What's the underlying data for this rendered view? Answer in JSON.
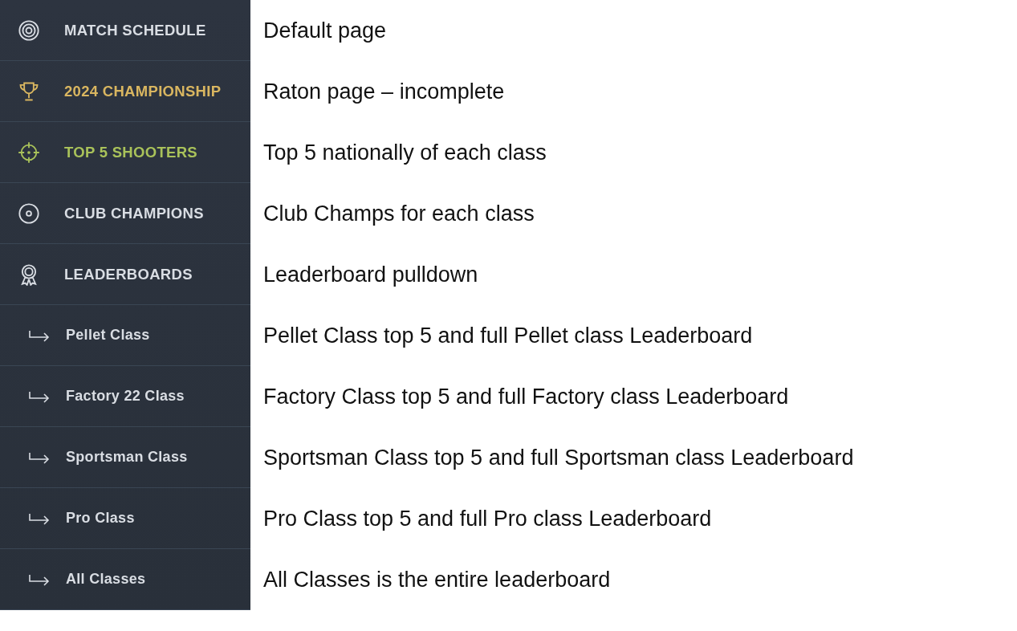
{
  "sidebar": {
    "items": [
      {
        "label": "MATCH SCHEDULE",
        "color": "#d9dde3"
      },
      {
        "label": "2024 CHAMPIONSHIP",
        "color": "#d9b660"
      },
      {
        "label": "TOP 5 SHOOTERS",
        "color": "#a9c25a"
      },
      {
        "label": "CLUB CHAMPIONS",
        "color": "#d9dde3"
      },
      {
        "label": "LEADERBOARDS",
        "color": "#d9dde3",
        "children": [
          {
            "label": "Pellet Class"
          },
          {
            "label": "Factory 22 Class"
          },
          {
            "label": "Sportsman Class"
          },
          {
            "label": "Pro Class"
          },
          {
            "label": "All Classes"
          }
        ]
      }
    ]
  },
  "notes": [
    "Default page",
    "Raton page – incomplete",
    "Top 5 nationally of each class",
    "Club Champs for each class",
    "Leaderboard pulldown",
    "Pellet Class top 5 and full Pellet class Leaderboard",
    "Factory Class top 5 and full Factory class Leaderboard",
    "Sportsman Class top 5 and full Sportsman class Leaderboard",
    "Pro Class top 5 and full Pro class Leaderboard",
    "All Classes is the entire leaderboard"
  ]
}
